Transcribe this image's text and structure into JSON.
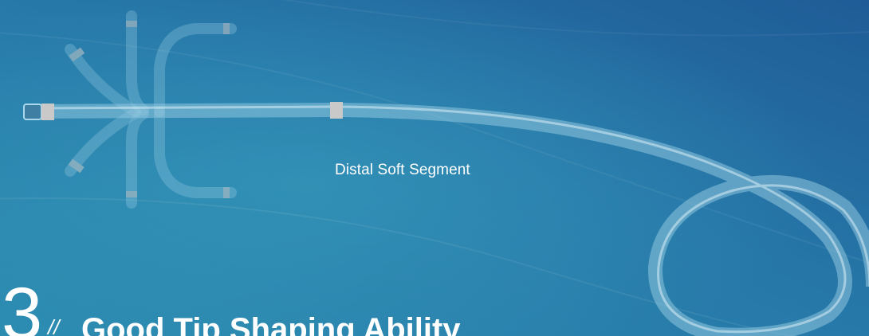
{
  "labels": {
    "segment": "Distal Soft Segment"
  },
  "feature": {
    "number": "3",
    "marks": "//",
    "title": "Good Tip Shaping Ability"
  },
  "colors": {
    "background_dark": "#1f5f98",
    "background_mid": "#2a86ae",
    "catheter": "#a9d7ec",
    "marker_band": "#c9c9c9",
    "text": "#ffffff"
  }
}
